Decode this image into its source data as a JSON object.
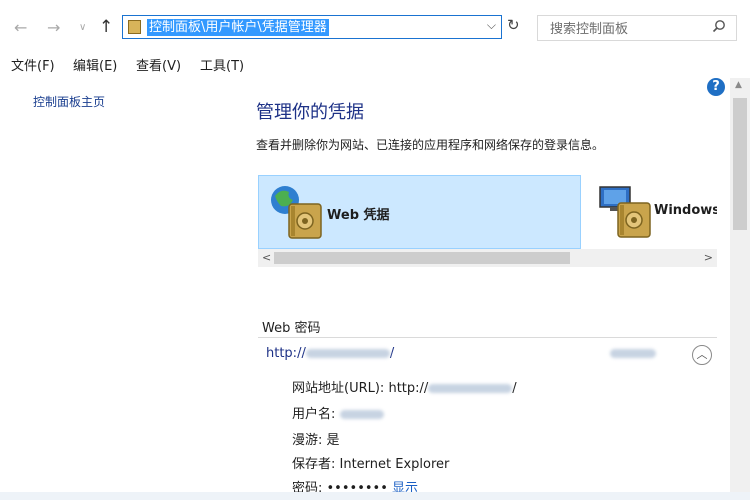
{
  "address": {
    "path": "控制面板\\用户帐户\\凭据管理器"
  },
  "search": {
    "placeholder": "搜索控制面板"
  },
  "menu": {
    "file": "文件(F)",
    "edit": "编辑(E)",
    "view": "查看(V)",
    "tools": "工具(T)"
  },
  "left_pane": {
    "home_link": "控制面板主页"
  },
  "main": {
    "title": "管理你的凭据",
    "description": "查看并删除你为网站、已连接的应用程序和网络保存的登录信息。"
  },
  "tiles": {
    "web_label": "Web 凭据",
    "windows_label": "Windows"
  },
  "section": {
    "title": "Web 密码",
    "entry_url_prefix": "http://",
    "entry_url_suffix": "/",
    "details": {
      "site_label": "网站地址(URL): ",
      "site_prefix": "http://",
      "site_suffix": "/",
      "username_label": "用户名: ",
      "roaming": "漫游: 是",
      "saved_by_label": "保存者: ",
      "saved_by_value": "Internet Explorer",
      "password_label": "密码: ",
      "password_mask": "••••••••",
      "show_link": "显示"
    }
  },
  "icons": {
    "back": "arrow-left-icon",
    "forward": "arrow-right-icon",
    "recent": "chevron-down-icon",
    "up": "arrow-up-icon",
    "refresh": "refresh-icon",
    "search": "search-icon",
    "help": "help-icon",
    "collapse": "chevron-up-icon"
  },
  "colors": {
    "accent": "#1f6fc4",
    "selection": "#3399ff",
    "tile_selected": "#cce8ff",
    "link": "#1a5fc4"
  }
}
